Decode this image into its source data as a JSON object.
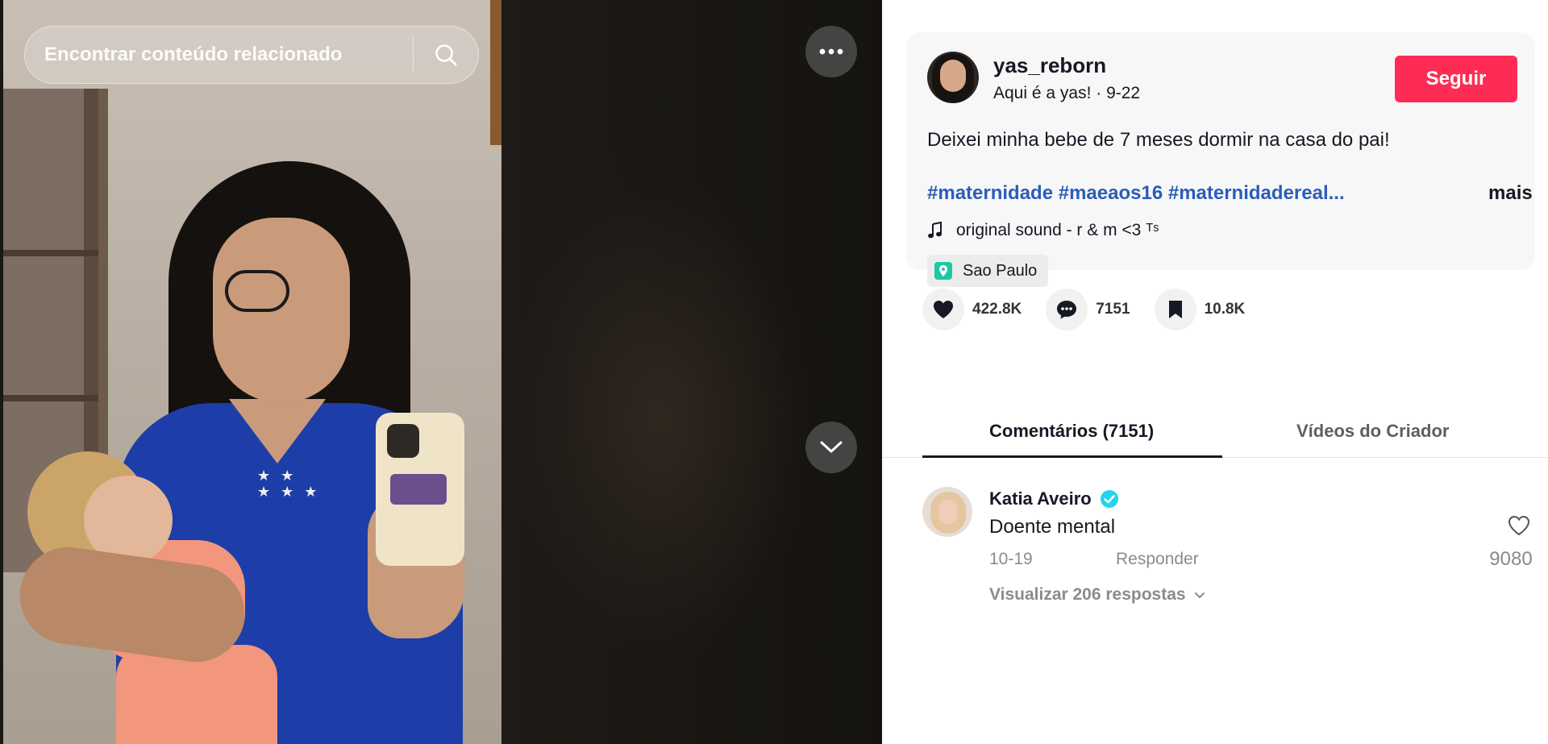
{
  "search": {
    "placeholder": "Encontrar conteúdo relacionado"
  },
  "video": {
    "more_icon": "more-horizontal-icon",
    "next_icon": "chevron-down-icon"
  },
  "author": {
    "username": "yas_reborn",
    "nickname": "Aqui é a yas!",
    "separator": " · ",
    "date": "9-22",
    "follow_label": "Seguir"
  },
  "post": {
    "caption": "Deixei minha bebe de 7 meses dormir na casa do pai!",
    "hashtags": [
      "#maternidade",
      "#maeaos16",
      "#maternidadereal..."
    ],
    "more_label": "mais",
    "sound": "original sound - r & m <3 ᵀˢ",
    "location": "Sao Paulo"
  },
  "stats": {
    "likes": "422.8K",
    "comments": "7151",
    "saves": "10.8K"
  },
  "tabs": [
    {
      "label": "Comentários (7151)",
      "active": true
    },
    {
      "label": "Vídeos do Criador",
      "active": false
    }
  ],
  "comments": [
    {
      "author": "Katia Aveiro",
      "verified": true,
      "text": "Doente mental",
      "date": "10-19",
      "reply_label": "Responder",
      "likes": "9080",
      "view_replies": "Visualizar 206 respostas"
    }
  ],
  "colors": {
    "accent": "#fe2c55",
    "hashtag": "#2b5db9",
    "verified": "#20d5ec",
    "location_pin": "#1ec7a5"
  }
}
